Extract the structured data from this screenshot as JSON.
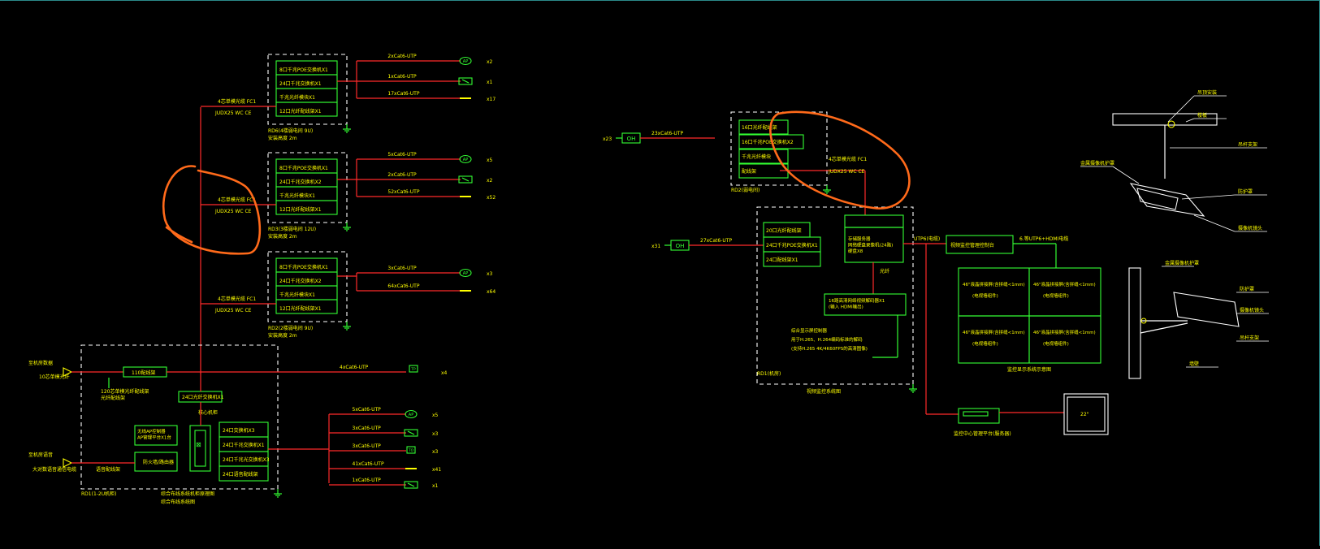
{
  "colors": {
    "background": "#000000",
    "line": "#ff2a2a",
    "box": "#33ff33",
    "text": "#ffff00",
    "dash": "#ffffff",
    "annotation": "#ff6a1a"
  },
  "left": {
    "rack1": {
      "modules": [
        "8口千兆POE交换机X1",
        "24口千兆交换机X1",
        "千兆光纤模块X1",
        "12口光纤配线架X1"
      ],
      "caption_main": "RD6(4楼弱电间 9U)",
      "caption_sub": "安装高度 2m",
      "uplink_a": "4芯单模光缆 FC1",
      "uplink_b": "JUDX25 WC CE",
      "cables": [
        "2xCat6-UTP",
        "1xCat6-UTP",
        "17xCat6-UTP"
      ],
      "counts": [
        "x2",
        "x1",
        "x17"
      ],
      "icon_labels": [
        "AP",
        "",
        ""
      ]
    },
    "rack2": {
      "modules": [
        "8口千兆POE交换机X1",
        "24口千兆交换机X2",
        "千兆光纤模块X1",
        "12口光纤配线架X1"
      ],
      "caption_main": "RD3(3楼弱电间 12U)",
      "caption_sub": "安装高度 2m",
      "uplink_a": "4芯单模光缆 FC1",
      "uplink_b": "JUDX25 WC CE",
      "cables": [
        "5xCat6-UTP",
        "2xCat6-UTP",
        "52xCat6-UTP"
      ],
      "counts": [
        "x5",
        "x2",
        "x52"
      ],
      "icon_labels": [
        "AP",
        "",
        ""
      ]
    },
    "rack3": {
      "modules": [
        "8口千兆POE交换机X1",
        "24口千兆交换机X2",
        "千兆光纤模块X1",
        "12口光纤配线架X1"
      ],
      "caption_main": "RD2(2楼弱电间 9U)",
      "caption_sub": "安装高度 2m",
      "uplink_a": "4芯单模光缆 FC1",
      "uplink_b": "JUDX25 WC CE",
      "cables": [
        "3xCat6-UTP",
        "64xCat6-UTP"
      ],
      "counts": [
        "x3",
        "x64"
      ],
      "icon_labels": [
        "AP",
        ""
      ]
    },
    "main": {
      "in1_label": "至机房数据",
      "in1_sub": "10芯单模光纤",
      "in2_label": "至机房语音",
      "in2_sub": "大对数语音通信电缆",
      "module_mid": "110配线架",
      "note_mid": "120芯单模光纤配线架",
      "note_mid2": "光纤配线架",
      "switch_core": "24口光纤交换机X1",
      "core_label": "核心机柜",
      "ap_ctrl": "无线AP控制器\nAP管理平台X1台",
      "fw": "防火墙/路由器",
      "tel": "语音配线架",
      "right_modules": [
        "24口交换机X3",
        "24口千兆交换机X1",
        "24口千兆光交换机X3",
        "24口语音配线架"
      ],
      "caption_main": "RD1(1-2U机柜)",
      "caption_sub": "综合布线系统机柜原理图",
      "bottom_cap": "综合布线系统图",
      "top_cable": "4xCat6-UTP",
      "top_count": "x4",
      "cables": [
        "5xCat6-UTP",
        "3xCat6-UTP",
        "3xCat6-UTP",
        "41xCat6-UTP",
        "1xCat6-UTP"
      ],
      "counts": [
        "x5",
        "x3",
        "x3",
        "x41",
        "x1"
      ],
      "icon_labels": [
        "AP",
        "",
        "TO",
        "",
        ""
      ]
    }
  },
  "right": {
    "oh_label": "OH",
    "oh_count_top": "x23",
    "oh_count_bot": "x31",
    "oh_cable_top": "23xCat6-UTP",
    "oh_cable_bot": "27xCat6-UTP",
    "rack_top": {
      "modules": [
        "16口光纤配线架",
        "16口千兆POE交换机X2",
        "千兆光纤模块",
        "配线架"
      ],
      "caption": "RD2(弱电间)",
      "uplink_a": "4芯单模光缆 FC1",
      "uplink_b": "JUDX25 WC CE"
    },
    "rack_bot": {
      "modules": [
        "20口光纤配线架",
        "24口千兆POE交换机X1",
        "24口配线架X1"
      ],
      "nvr": "存储服务器\n网络硬盘录像机(24路)\n硬盘X8",
      "decoder": "16路高清网络视频解码器X1\n(输入 HDMI输出)",
      "note1": "综合显示屏控制器",
      "note2": "用于H.265、H.264编码标准的解码",
      "note3": "(支持H.265 4K/4K60FPS的高清图像)",
      "caption": "RD1(机房)",
      "bottom": "视频监控系统图",
      "mid_label": "光纤",
      "hdmi_label": "HDMI",
      "link": "UTP6(电缆)"
    },
    "wall": {
      "ctrl": "视频监控管理控制台",
      "cable": "6.等UTP6+HDMI电缆",
      "cells": [
        "46\"液晶拼接屏(含拼缝<1mm)",
        "46\"液晶拼接屏(含拼缝<1mm)",
        "46\"液晶拼接屏(含拼缝<1mm)",
        "46\"液晶拼接屏(含拼缝<1mm)"
      ],
      "cells_sub": [
        "(电视墙组件)",
        "(电视墙组件)",
        "(电视墙组件)",
        "(电视墙组件)"
      ],
      "caption": "监控显示系统示意图"
    },
    "console": {
      "label": "监控中心管理平台(服务器)"
    },
    "monitor": {
      "label": "22\""
    },
    "camera_ceiling": {
      "labels": [
        "吊顶安装",
        "楼板",
        "吊杆支架",
        "金属摄像机护罩",
        "防护罩",
        "摄像机镜头"
      ]
    },
    "camera_wall": {
      "labels": [
        "金属摄像机护罩",
        "防护罩",
        "摄像机镜头",
        "吊杆支架",
        "墙壁"
      ]
    }
  }
}
